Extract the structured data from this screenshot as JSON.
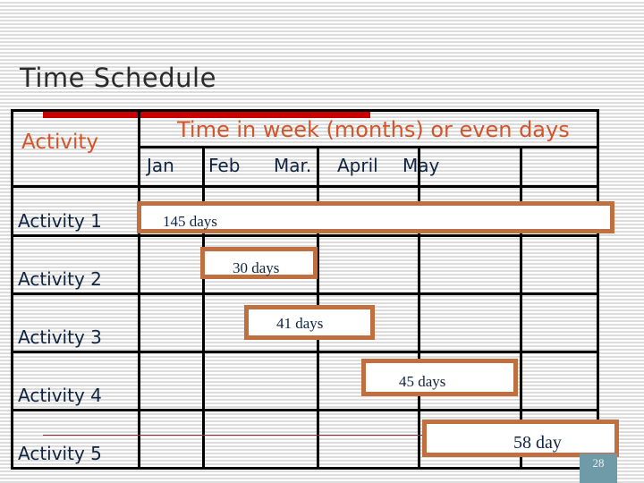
{
  "slide": {
    "title": "Time Schedule",
    "page_number": "28"
  },
  "table": {
    "header": {
      "activity_label": "Activity",
      "time_label": "Time in week (months) or even days",
      "months": [
        "Jan",
        "Feb",
        "Mar.",
        "April",
        "May"
      ]
    },
    "activities": [
      "Activity 1",
      "Activity 2",
      "Activity 3",
      "Activity 4",
      "Activity 5"
    ],
    "bars": [
      {
        "activity": "Activity 1",
        "label": "145 days"
      },
      {
        "activity": "Activity 2",
        "label": "30 days"
      },
      {
        "activity": "Activity 3",
        "label": "41 days"
      },
      {
        "activity": "Activity 4",
        "label": "45 days"
      },
      {
        "activity": "Activity 5",
        "label": "58 day"
      }
    ]
  },
  "colors": {
    "accent_red": "#c80000",
    "header_text": "#d2552a",
    "bar_border": "#c07040",
    "body_text": "#0f2440"
  }
}
